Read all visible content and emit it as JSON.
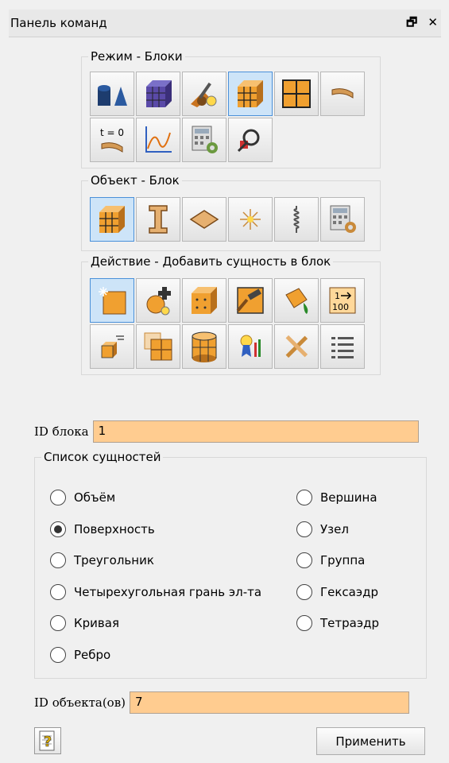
{
  "window": {
    "title": "Панель команд",
    "float_glyph": "🗗",
    "close_glyph": "✕"
  },
  "mode_group": {
    "legend": "Режим - Блоки",
    "row1": [
      "geometry-icon",
      "mesh-icon",
      "settings-wrench-icon",
      "blocks-icon",
      "grid-icon",
      "curve-segment-icon"
    ],
    "row2": [
      "time-zero-icon",
      "graph-icon",
      "calculator-settings-icon",
      "magnifier-icon"
    ],
    "active": "blocks-icon"
  },
  "object_group": {
    "legend": "Объект - Блок",
    "row1": [
      "block-icon",
      "beam-icon",
      "shell-icon",
      "spider-icon",
      "spring-icon",
      "calculator-settings-icon"
    ],
    "active": "block-icon"
  },
  "action_group": {
    "legend": "Действие - Добавить сущность в блок",
    "row1": [
      "add-entity-icon",
      "add-node-icon",
      "cube-nodes-icon",
      "hammer-icon",
      "paint-bucket-icon",
      "numbering-icon"
    ],
    "row2": [
      "list-cube-icon",
      "split-grid-icon",
      "cylinder-grid-icon",
      "ribbon-icon",
      "tools-cross-icon",
      "list-icon"
    ],
    "active": "add-entity-icon",
    "numbering_text": {
      "top": "1",
      "bottom": "100"
    }
  },
  "block_id": {
    "label": "ID блока",
    "value": "1"
  },
  "entity_list": {
    "legend": "Список сущностей",
    "left": [
      {
        "label": "Объём",
        "checked": false
      },
      {
        "label": "Поверхность",
        "checked": true
      },
      {
        "label": "Треугольник",
        "checked": false
      },
      {
        "label": "Четырехугольная грань эл-та",
        "checked": false
      },
      {
        "label": "Кривая",
        "checked": false
      },
      {
        "label": "Ребро",
        "checked": false
      }
    ],
    "right": [
      {
        "label": "Вершина",
        "checked": false
      },
      {
        "label": "Узел",
        "checked": false
      },
      {
        "label": "Группа",
        "checked": false
      },
      {
        "label": "Гексаэдр",
        "checked": false
      },
      {
        "label": "Тетраэдр",
        "checked": false
      }
    ]
  },
  "object_id": {
    "label": "ID объекта(ов)",
    "value": "7"
  },
  "help_button": {
    "icon": "help-icon",
    "glyph": "?"
  },
  "apply_button": {
    "label": "Применить"
  },
  "colors": {
    "field_bg": "#ffcc90",
    "active_btn": "#cde4f8",
    "block_orange": "#f0a030"
  }
}
